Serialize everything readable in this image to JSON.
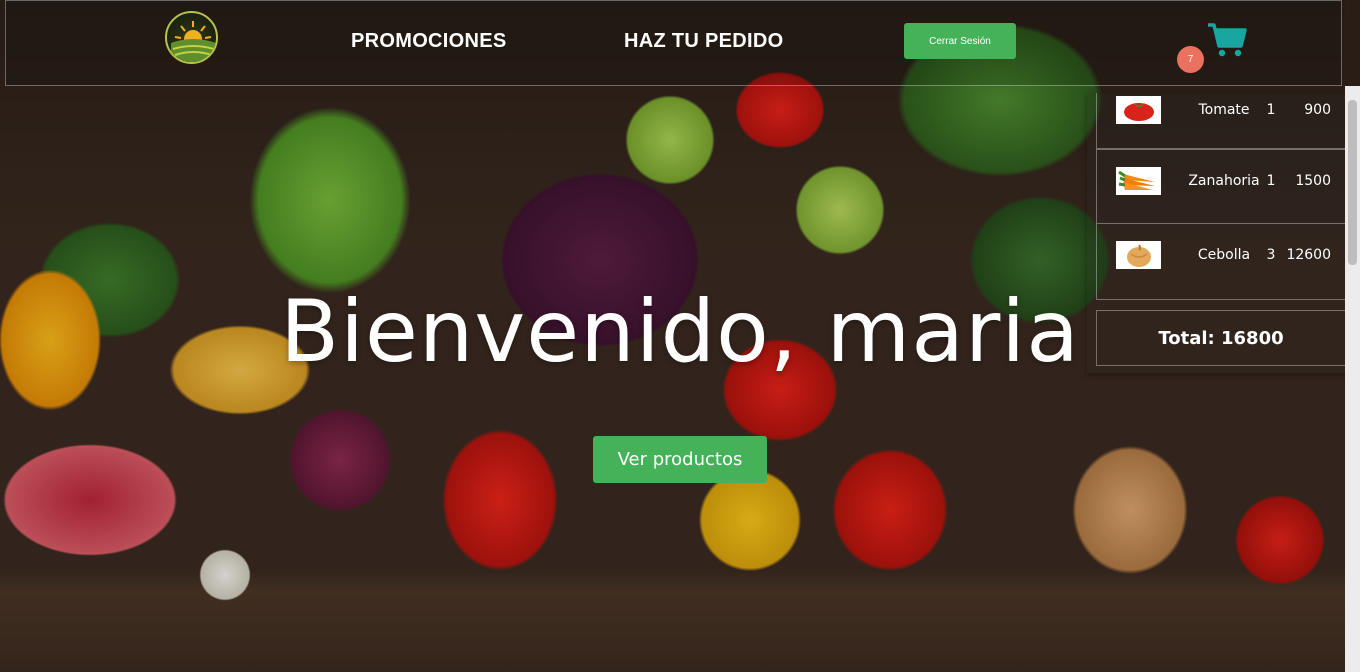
{
  "nav": {
    "logo_icon": "farm-sun-logo",
    "links": [
      "PROMOCIONES",
      "HAZ TU PEDIDO"
    ],
    "logout_label": "Cerrar Sesión",
    "cart_icon": "shopping-cart-icon",
    "cart_count": "7"
  },
  "cart": {
    "items": [
      {
        "name": "Tomate",
        "qty": "1",
        "price": "900",
        "icon": "tomato-icon"
      },
      {
        "name": "Zanahoria",
        "qty": "1",
        "price": "1500",
        "icon": "carrot-icon"
      },
      {
        "name": "Cebolla",
        "qty": "3",
        "price": "12600",
        "icon": "onion-icon"
      }
    ],
    "total_label": "Total: 16800"
  },
  "hero": {
    "title": "Bienvenido, maria",
    "button_label": "Ver productos"
  },
  "colors": {
    "accent_green": "#45b25a",
    "badge": "#e8715f",
    "cart_icon": "#1aa6a0"
  }
}
